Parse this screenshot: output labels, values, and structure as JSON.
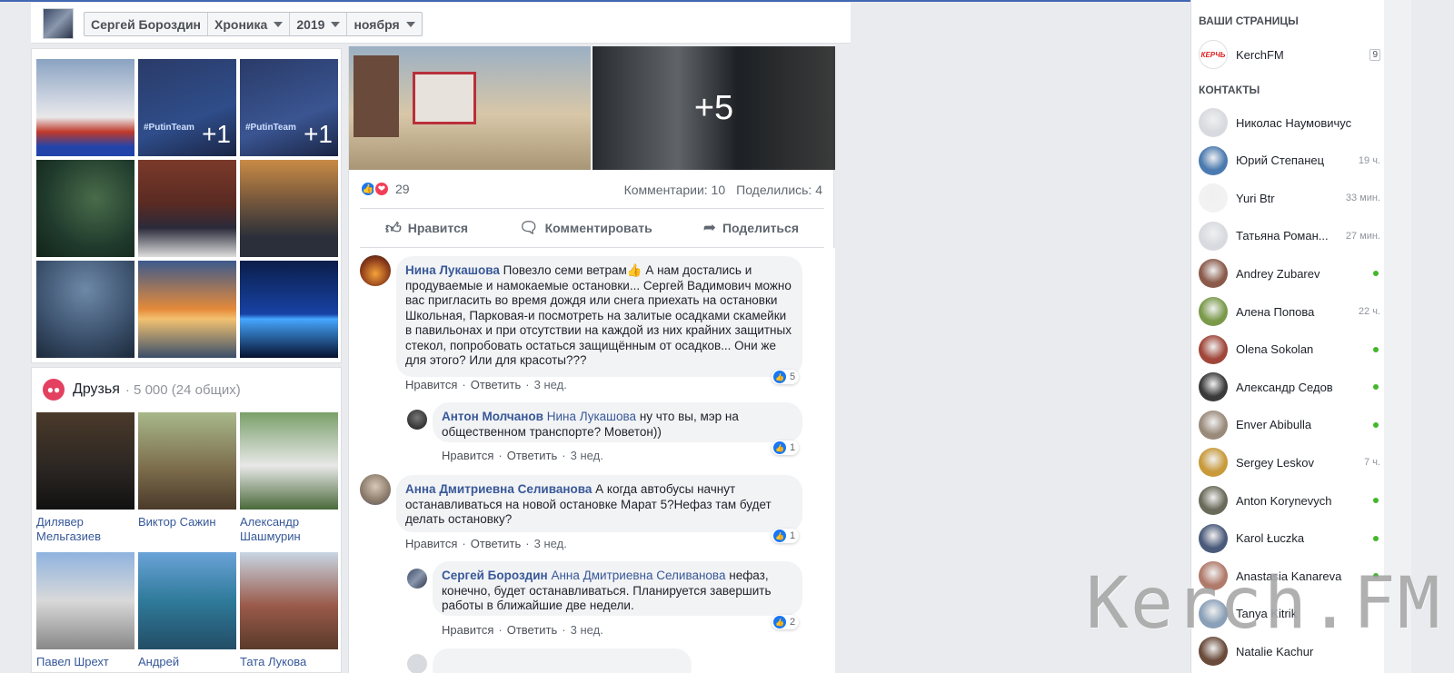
{
  "nav": {
    "profile_name": "Сергей Бороздин",
    "section": "Хроника",
    "year": "2019",
    "month": "ноября"
  },
  "photos": {
    "tiles": [
      {
        "overlay": "",
        "tag": ""
      },
      {
        "overlay": "+1",
        "tag": "#PutinTeam"
      },
      {
        "overlay": "+1",
        "tag": "#PutinTeam"
      },
      {
        "overlay": "",
        "tag": ""
      },
      {
        "overlay": "",
        "tag": ""
      },
      {
        "overlay": "",
        "tag": ""
      },
      {
        "overlay": "",
        "tag": ""
      },
      {
        "overlay": "",
        "tag": ""
      },
      {
        "overlay": "",
        "tag": ""
      }
    ]
  },
  "friends": {
    "title": "Друзья",
    "count": "· 5 000 (24 общих)",
    "list": [
      {
        "name": "Дилявер Мельгазиев"
      },
      {
        "name": "Виктор Сажин"
      },
      {
        "name": "Александр Шашмурин"
      },
      {
        "name": "Павел Шрехт"
      },
      {
        "name": "Андрей"
      },
      {
        "name": "Тата Лукова"
      }
    ]
  },
  "post": {
    "more_photos": "+5",
    "reaction_count": "29",
    "comments_count": "Комментарии: 10",
    "shares_count": "Поделились: 4",
    "actions": {
      "like": "Нравится",
      "comment": "Комментировать",
      "share": "Поделиться"
    }
  },
  "comments": [
    {
      "author": "Нина Лукашова",
      "target": "",
      "text": "Повезло семи ветрам👍 А нам достались и продуваемые и намокаемые остановки... Сергей Вадимович можно вас пригласить во время дождя или снега приехать на остановки Школьная, Парковая-и посмотреть на залитые осадками скамейки в павильонах и при отсутствии на каждой из них крайних защитных стекол, попробовать остаться защищённым от осадков... Они же для этого? Или для красоты???",
      "like_label": "Нравится",
      "reply_label": "Ответить",
      "time": "3 нед.",
      "likes": "5"
    },
    {
      "author": "Антон Молчанов",
      "target": "Нина Лукашова",
      "text": "ну что вы, мэр на общественном транспорте? Моветон))",
      "like_label": "Нравится",
      "reply_label": "Ответить",
      "time": "3 нед.",
      "likes": "1"
    },
    {
      "author": "Анна Дмитриевна Селиванова",
      "target": "",
      "text": "А когда автобусы начнут останавливаться на новой остановке Марат 5?Нефаз там будет делать остановку?",
      "like_label": "Нравится",
      "reply_label": "Ответить",
      "time": "3 нед.",
      "likes": "1"
    },
    {
      "author": "Сергей Бороздин",
      "target": "Анна Дмитриевна Селиванова",
      "text": "нефаз, конечно, будет останавливаться. Планируется завершить работы в ближайшие две недели.",
      "like_label": "Нравится",
      "reply_label": "Ответить",
      "time": "3 нед.",
      "likes": "2"
    }
  ],
  "sidebar": {
    "pages_heading": "ВАШИ СТРАНИЦЫ",
    "pages": [
      {
        "name": "KerchFM",
        "badge": "9",
        "logo_text": "КЕРЧЬ"
      }
    ],
    "contacts_heading": "КОНТАКТЫ",
    "contacts": [
      {
        "name": "Николас Наумовичус",
        "time": "",
        "online": false,
        "color": "#d8dadf"
      },
      {
        "name": "Юрий Степанец",
        "time": "19 ч.",
        "online": false,
        "color": "#4a7ab0"
      },
      {
        "name": "Yuri Btr",
        "time": "33 мин.",
        "online": false,
        "color": "#f2f2f2"
      },
      {
        "name": "Татьяна Роман...",
        "time": "27 мин.",
        "online": false,
        "color": "#d8dadf"
      },
      {
        "name": "Andrey Zubarev",
        "time": "",
        "online": true,
        "color": "#8a5a4a"
      },
      {
        "name": "Алена Попова",
        "time": "22 ч.",
        "online": false,
        "color": "#7a9a4a"
      },
      {
        "name": "Olena Sokolan",
        "time": "",
        "online": true,
        "color": "#a0463a"
      },
      {
        "name": "Александр Седов",
        "time": "",
        "online": true,
        "color": "#3a3a3a"
      },
      {
        "name": "Enver Abibulla",
        "time": "",
        "online": true,
        "color": "#9a8a7a"
      },
      {
        "name": "Sergey Leskov",
        "time": "7 ч.",
        "online": false,
        "color": "#c89a3a"
      },
      {
        "name": "Anton Korynevych",
        "time": "",
        "online": true,
        "color": "#6a6a5a"
      },
      {
        "name": "Karol Łuczka",
        "time": "",
        "online": true,
        "color": "#4a5a7a"
      },
      {
        "name": "Anastasia Kanareva",
        "time": "",
        "online": true,
        "color": "#b07a6a"
      },
      {
        "name": "Tanya Kitrik",
        "time": "",
        "online": false,
        "color": "#8aa0b8"
      },
      {
        "name": "Natalie Kachur",
        "time": "",
        "online": false,
        "color": "#6a4a3a"
      }
    ]
  },
  "watermark": "Kerch.FM"
}
